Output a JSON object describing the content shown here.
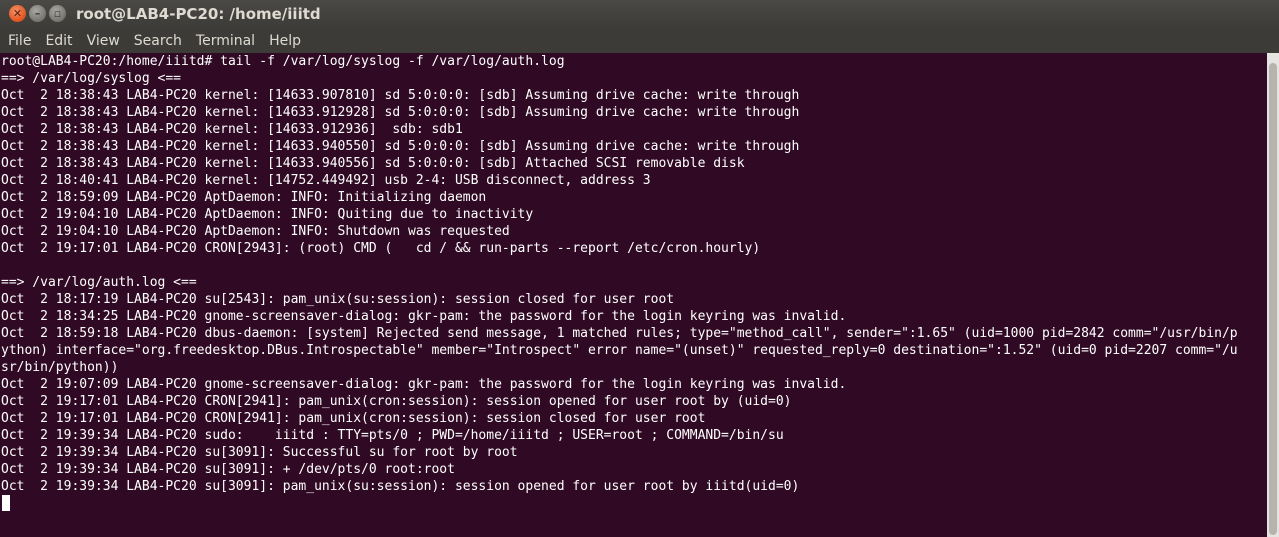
{
  "window": {
    "title": "root@LAB4-PC20: /home/iiitd",
    "controls": [
      "close-icon",
      "minimize-icon",
      "maximize-icon"
    ]
  },
  "menubar": {
    "items": [
      "File",
      "Edit",
      "View",
      "Search",
      "Terminal",
      "Help"
    ]
  },
  "terminal": {
    "lines": [
      "root@LAB4-PC20:/home/iiitd# tail -f /var/log/syslog -f /var/log/auth.log",
      "==> /var/log/syslog <==",
      "Oct  2 18:38:43 LAB4-PC20 kernel: [14633.907810] sd 5:0:0:0: [sdb] Assuming drive cache: write through",
      "Oct  2 18:38:43 LAB4-PC20 kernel: [14633.912928] sd 5:0:0:0: [sdb] Assuming drive cache: write through",
      "Oct  2 18:38:43 LAB4-PC20 kernel: [14633.912936]  sdb: sdb1",
      "Oct  2 18:38:43 LAB4-PC20 kernel: [14633.940550] sd 5:0:0:0: [sdb] Assuming drive cache: write through",
      "Oct  2 18:38:43 LAB4-PC20 kernel: [14633.940556] sd 5:0:0:0: [sdb] Attached SCSI removable disk",
      "Oct  2 18:40:41 LAB4-PC20 kernel: [14752.449492] usb 2-4: USB disconnect, address 3",
      "Oct  2 18:59:09 LAB4-PC20 AptDaemon: INFO: Initializing daemon",
      "Oct  2 19:04:10 LAB4-PC20 AptDaemon: INFO: Quiting due to inactivity",
      "Oct  2 19:04:10 LAB4-PC20 AptDaemon: INFO: Shutdown was requested",
      "Oct  2 19:17:01 LAB4-PC20 CRON[2943]: (root) CMD (   cd / && run-parts --report /etc/cron.hourly)",
      "",
      "==> /var/log/auth.log <==",
      "Oct  2 18:17:19 LAB4-PC20 su[2543]: pam_unix(su:session): session closed for user root",
      "Oct  2 18:34:25 LAB4-PC20 gnome-screensaver-dialog: gkr-pam: the password for the login keyring was invalid.",
      "Oct  2 18:59:18 LAB4-PC20 dbus-daemon: [system] Rejected send message, 1 matched rules; type=\"method_call\", sender=\":1.65\" (uid=1000 pid=2842 comm=\"/usr/bin/p",
      "ython) interface=\"org.freedesktop.DBus.Introspectable\" member=\"Introspect\" error name=\"(unset)\" requested_reply=0 destination=\":1.52\" (uid=0 pid=2207 comm=\"/u",
      "sr/bin/python))",
      "Oct  2 19:07:09 LAB4-PC20 gnome-screensaver-dialog: gkr-pam: the password for the login keyring was invalid.",
      "Oct  2 19:17:01 LAB4-PC20 CRON[2941]: pam_unix(cron:session): session opened for user root by (uid=0)",
      "Oct  2 19:17:01 LAB4-PC20 CRON[2941]: pam_unix(cron:session): session closed for user root",
      "Oct  2 19:39:34 LAB4-PC20 sudo:    iiitd : TTY=pts/0 ; PWD=/home/iiitd ; USER=root ; COMMAND=/bin/su",
      "Oct  2 19:39:34 LAB4-PC20 su[3091]: Successful su for root by root",
      "Oct  2 19:39:34 LAB4-PC20 su[3091]: + /dev/pts/0 root:root",
      "Oct  2 19:39:34 LAB4-PC20 su[3091]: pam_unix(su:session): session opened for user root by iiitd(uid=0)"
    ]
  },
  "colors": {
    "terminal_bg": "#300a24",
    "terminal_fg": "#ffffff",
    "chrome_bg": "#3c3b37",
    "close_button": "#e0541e"
  }
}
